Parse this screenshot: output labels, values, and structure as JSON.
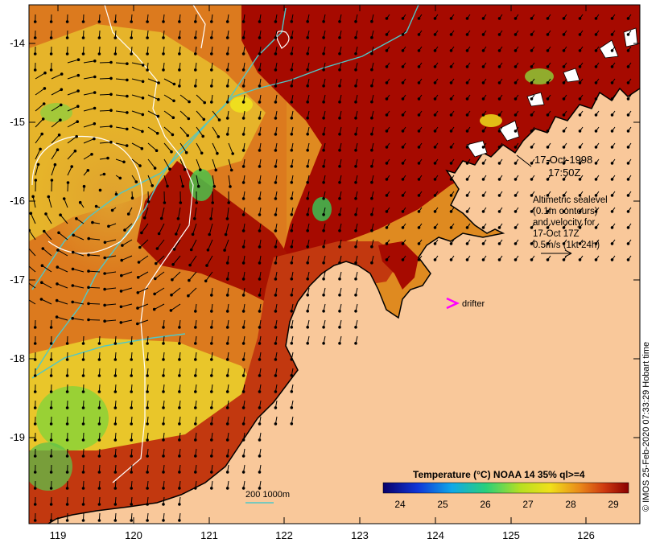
{
  "map": {
    "lat_labels": [
      "-14",
      "-15",
      "-16",
      "-17",
      "-18",
      "-19"
    ],
    "lon_labels": [
      "119",
      "120",
      "121",
      "122",
      "123",
      "124",
      "125",
      "126"
    ],
    "colors": {
      "land": "#f9c89a",
      "hot": "#a60a00",
      "warm": "#d8531a",
      "mid": "#e79a22",
      "cool": "#e8c324",
      "yellow": "#f1e81c",
      "green": "#7ed43a",
      "contour_white": "#ffffff",
      "isobath": "#4fc8c8",
      "drifter": "#ff00ff",
      "arrow": "#000000"
    }
  },
  "annotation": {
    "date": "17-Oct-1998",
    "time": "17:50Z",
    "line1": "Altimetric sealevel",
    "line2": "(0.1m contours)",
    "line3": "and velocity for",
    "line4": "17-Oct 17Z",
    "line5": "0.5m/s (1kt 24h)"
  },
  "drifter": {
    "label": "drifter"
  },
  "isobath_legend": {
    "label": "200  1000m"
  },
  "colorbar": {
    "title": "Temperature (°C) NOAA 14 35% ql>=4",
    "ticks": [
      "24",
      "25",
      "26",
      "27",
      "28",
      "29"
    ],
    "min": 23.4,
    "max": 29.4
  },
  "credit": "© IMOS 25-Feb-2020 07:33:29 Hobart time"
}
